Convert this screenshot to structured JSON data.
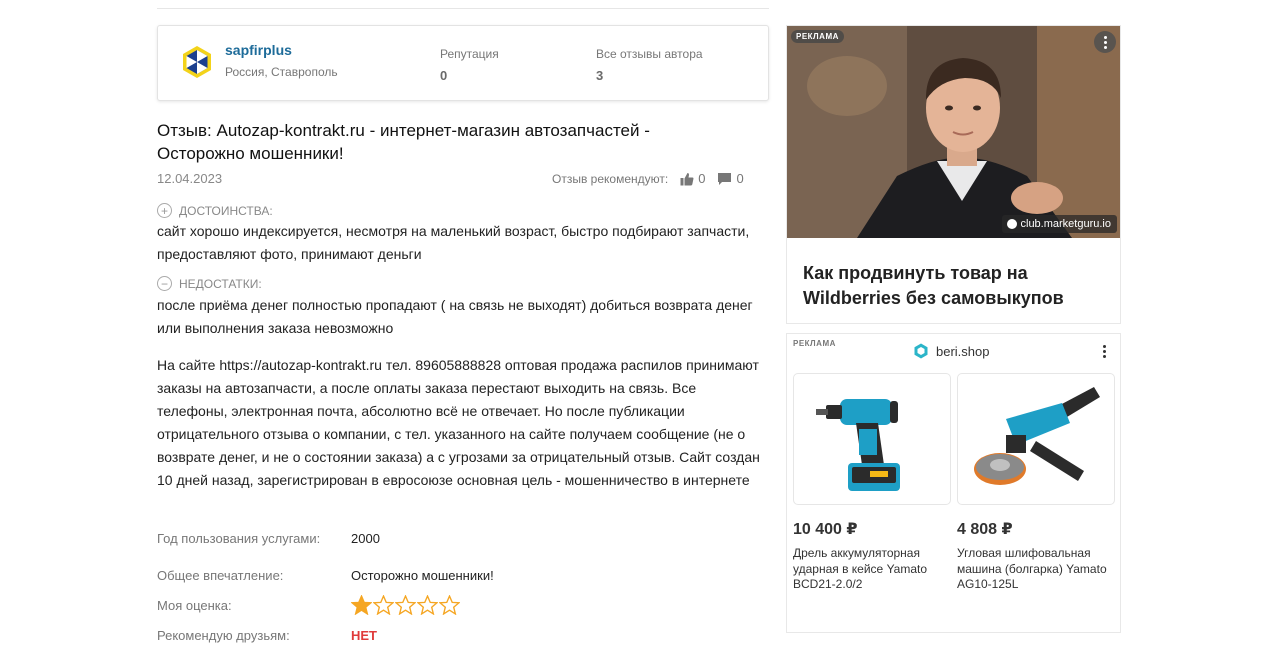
{
  "author": {
    "name": "sapfirplus",
    "location": "Россия, Ставрополь",
    "reputation_label": "Репутация",
    "reputation_value": "0",
    "reviews_label": "Все отзывы автора",
    "reviews_value": "3"
  },
  "review": {
    "title": "Отзыв: Autozap-kontrakt.ru - интернет-магазин автозапчастей - Осторожно мошенники!",
    "date": "12.04.2023",
    "recommend_label": "Отзыв рекомендуют:",
    "likes": "0",
    "comments": "0",
    "pros_label": "ДОСТОИНСТВА:",
    "pros_text": "сайт хорошо индексируется, несмотря на маленький возраст, быстро подбирают запчасти, предоставляют фото, принимают деньги",
    "cons_label": "НЕДОСТАТКИ:",
    "cons_text": "после приёма денег полностью пропадают ( на связь не выходят) добиться возврата денег или выполнения заказа невозможно",
    "body": "На сайте https://autozap-kontrakt.ru тел. 89605888828 оптовая продажа распилов принимают заказы на автозапчасти, а после оплаты заказа перестают выходить на связь. Все телефоны, электронная почта, абсолютно всё не отвечает. Но после публикации отрицательного отзыва о компании, с тел. указанного на сайте получаем сообщение (не о возврате денег, и не о состоянии заказа) а с угрозами за отрицательный отзыв. Сайт создан 10 дней назад, зарегистрирован в евросоюзе основная цель - мошенничество в интернете",
    "year_label": "Год пользования услугами:",
    "year_value": "2000",
    "impression_label": "Общее впечатление:",
    "impression_value": "Осторожно мошенники!",
    "rating_label": "Моя оценка:",
    "rating_value": 1,
    "rating_max": 5,
    "recommend_friends_label": "Рекомендую друзьям:",
    "recommend_friends_value": "НЕТ"
  },
  "ad1": {
    "badge": "РЕКЛАМА",
    "site": "club.marketguru.io",
    "title": "Как продвинуть товар на Wildberries без самовыкупов"
  },
  "ad2": {
    "badge": "РЕКЛАМА",
    "brand": "beri.shop",
    "products": [
      {
        "price": "10 400 ₽",
        "name": "Дрель аккумуляторная ударная в кейсе Yamato BCD21-2.0/2"
      },
      {
        "price": "4 808 ₽",
        "name": "Угловая шлифовальная машина (болгарка) Yamato AG10-125L"
      }
    ]
  },
  "colors": {
    "link": "#1d6b99",
    "star": "#f5a623",
    "negative": "#e03b3b"
  }
}
